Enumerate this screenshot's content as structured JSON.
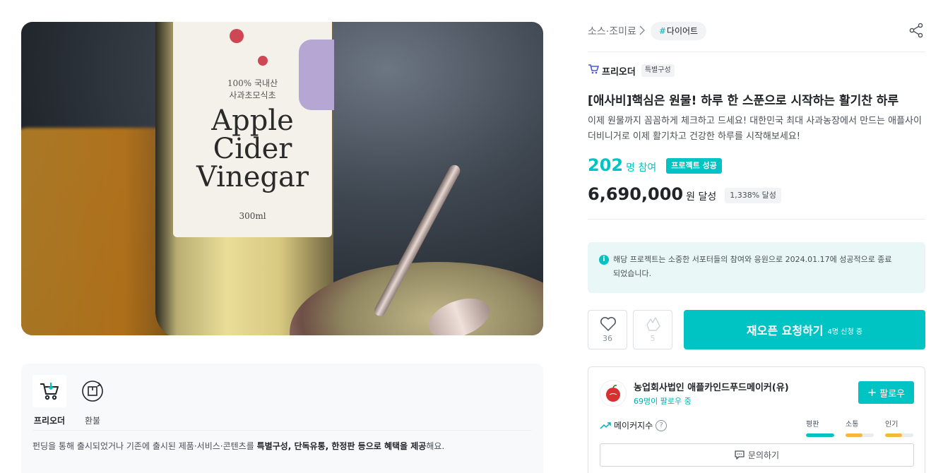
{
  "hero": {
    "label_line1": "100% 국내산",
    "label_line2": "사과초모식초",
    "label_product": "Apple Cider Vinegar",
    "label_volume": "300ml"
  },
  "badges": {
    "items": [
      {
        "label": "프리오더",
        "icon": "cart-icon"
      },
      {
        "label": "환불",
        "icon": "refund-icon"
      }
    ],
    "desc_pre": "펀딩을 통해 출시되었거나 기존에 출시된 제품·서비스·콘텐츠를 ",
    "desc_bold1": "특별구성, 단독유통, 한정판 등으로 혜택을 제공",
    "desc_post": "해요."
  },
  "breadcrumb": {
    "category": "소스·조미료",
    "tag_hash": "#",
    "tag": "다이어트"
  },
  "preorder": {
    "label": "프리오더",
    "sub": "특별구성"
  },
  "product": {
    "title": "[애사비]핵심은 원물! 하루 한 스푼으로 시작하는 활기찬 하루",
    "summary": "이제 원물까지 꼼꼼하게 체크하고 드세요! 대한민국 최대 사과농장에서 만드는 애플사이더비니거로 이제 활기차고 건강한 하루를 시작해보세요!"
  },
  "stats": {
    "participants": "202",
    "participants_unit": "명 참여",
    "success_badge": "프로젝트 성공",
    "amount": "6,690,000",
    "amount_unit": "원 달성",
    "percent": "1,338% 달성"
  },
  "notice": {
    "icon": "info-icon",
    "text": "해당 프로젝트는 소중한 서포터들의 참여와 응원으로 2024.01.17에 성공적으로 종료되었습니다."
  },
  "actions": {
    "like_count": "36",
    "cheer_count": "5",
    "reopen_label": "재오픈 요청하기",
    "reopen_sub": "4명 신청 중"
  },
  "maker": {
    "name": "농업회사법인 애플카인드푸드메이커(유)",
    "followers": "69명이 팔로우 중",
    "follow_label": "팔로우",
    "index_label": "메이커지수",
    "help": "?",
    "metrics": [
      {
        "label": "평판",
        "level": 1.0,
        "color": "#00c4c4"
      },
      {
        "label": "소통",
        "level": 0.6,
        "color": "#f6b73c"
      },
      {
        "label": "인기",
        "level": 0.6,
        "color": "#f6b73c"
      }
    ],
    "inquiry_label": "문의하기"
  },
  "colors": {
    "accent": "#00c4c4",
    "accent_text": "#00b2b2",
    "notice_bg": "#e9f7f7",
    "warn": "#f6b73c"
  }
}
